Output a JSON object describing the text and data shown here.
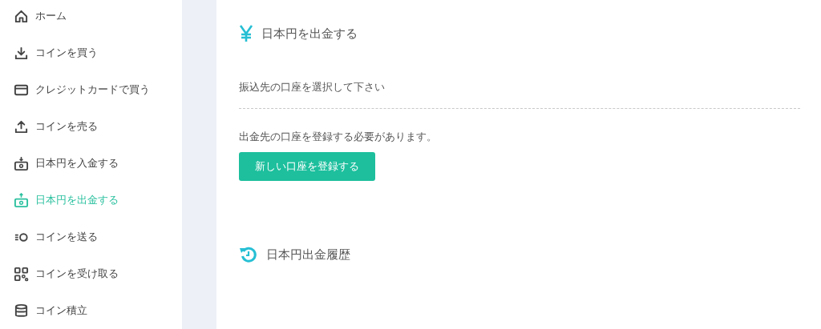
{
  "sidebar": {
    "items": [
      {
        "label": "ホーム",
        "selected": false
      },
      {
        "label": "コインを買う",
        "selected": false
      },
      {
        "label": "クレジットカードで買う",
        "selected": false
      },
      {
        "label": "コインを売る",
        "selected": false
      },
      {
        "label": "日本円を入金する",
        "selected": false
      },
      {
        "label": "日本円を出金する",
        "selected": true
      },
      {
        "label": "コインを送る",
        "selected": false
      },
      {
        "label": "コインを受け取る",
        "selected": false
      },
      {
        "label": "コイン積立",
        "selected": false
      }
    ]
  },
  "withdraw": {
    "title": "日本円を出金する",
    "select_label": "振込先の口座を選択して下さい",
    "notice": "出金先の口座を登録する必要があります。",
    "register_button": "新しい口座を登録する"
  },
  "history": {
    "title": "日本円出金履歴"
  }
}
